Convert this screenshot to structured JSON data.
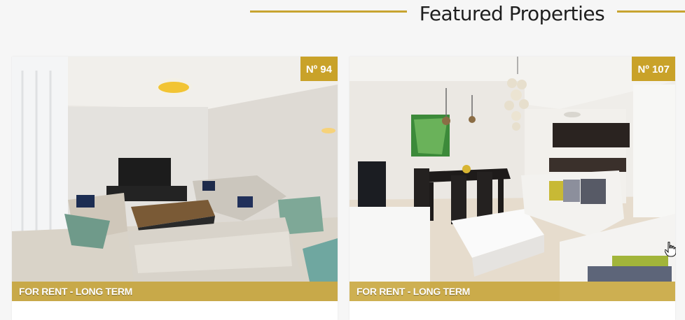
{
  "section": {
    "title": "Featured Properties"
  },
  "properties": [
    {
      "number": "Nº 94",
      "status": "FOR RENT - LONG TERM"
    },
    {
      "number": "Nº 107",
      "status": "FOR RENT - LONG TERM"
    }
  ],
  "colors": {
    "accent": "#c9a229",
    "background": "#f6f6f6",
    "title_text": "#1f1f1f"
  },
  "icons": {
    "cursor": "hand-cursor-icon"
  }
}
